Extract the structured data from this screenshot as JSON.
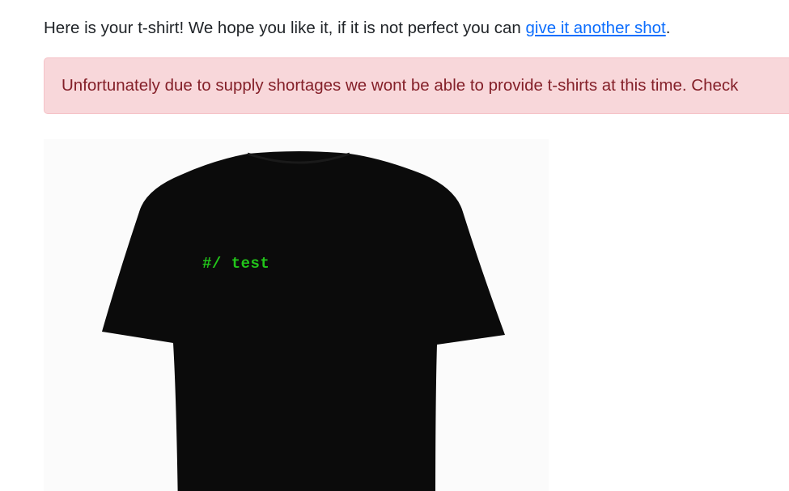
{
  "intro": {
    "before_link": "Here is your t-shirt! We hope you like it, if it is not perfect you can ",
    "link_text": "give it another shot",
    "after_link": "."
  },
  "alert": {
    "text": "Unfortunately due to supply shortages we wont be able to provide t-shirts at this time. Check"
  },
  "tshirt": {
    "print_text": "#/ test",
    "shirt_color": "#0b0b0b",
    "print_color": "#22c41a"
  }
}
